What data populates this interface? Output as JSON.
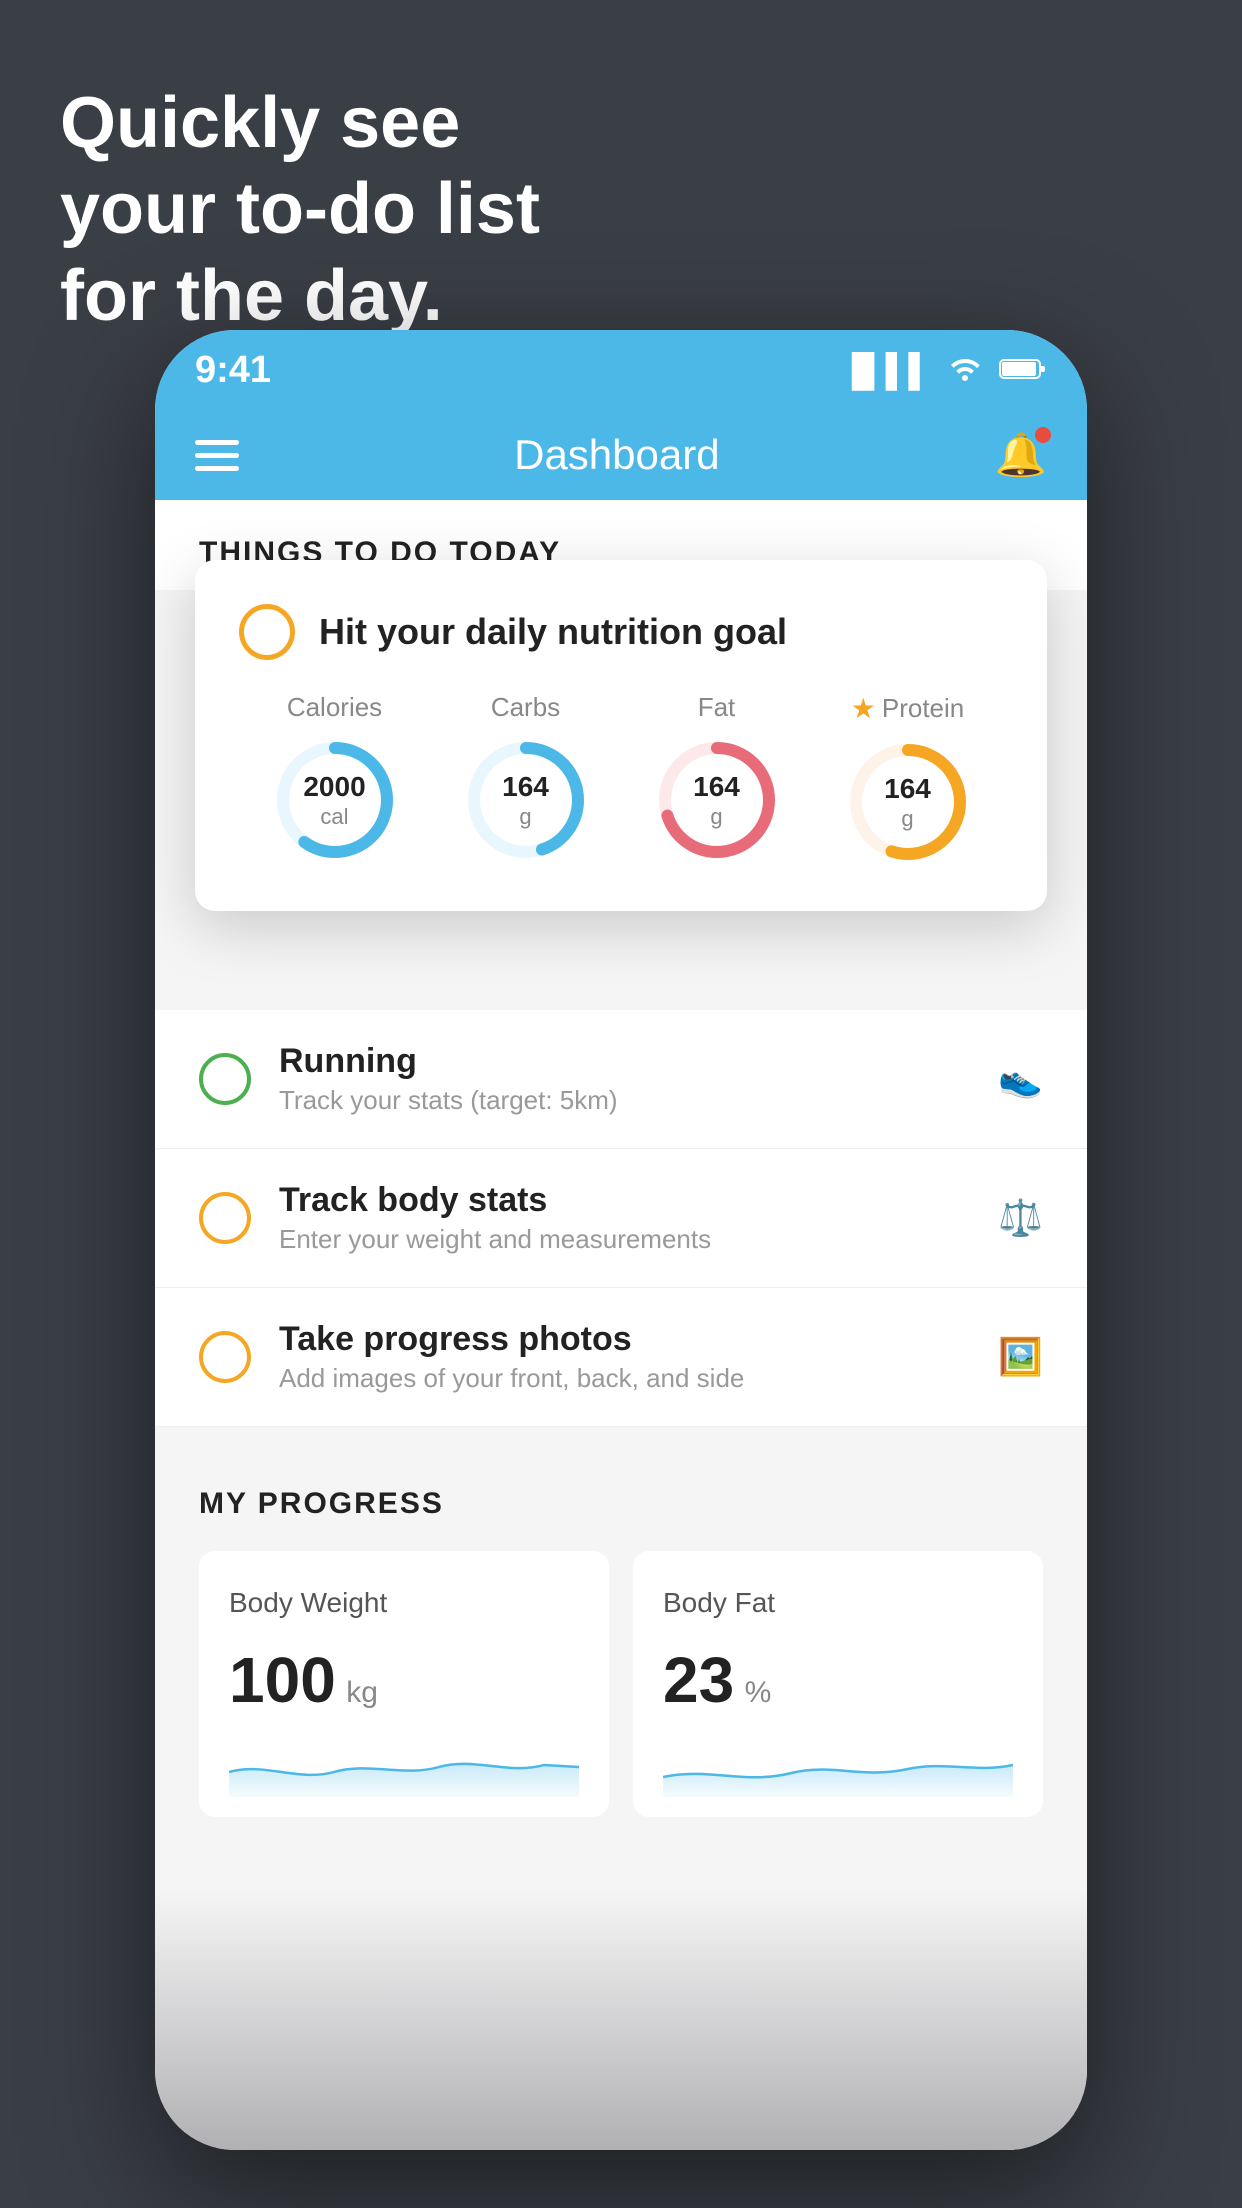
{
  "headline": {
    "line1": "Quickly see",
    "line2": "your to-do list",
    "line3": "for the day."
  },
  "statusBar": {
    "time": "9:41",
    "signal": "▐▌▌▌",
    "wifi": "wifi",
    "battery": "battery"
  },
  "navbar": {
    "title": "Dashboard"
  },
  "sectionHeader": {
    "title": "THINGS TO DO TODAY"
  },
  "floatingCard": {
    "title": "Hit your daily nutrition goal",
    "nutrition": [
      {
        "label": "Calories",
        "value": "2000",
        "unit": "cal",
        "color": "#4bb8e8",
        "bg": "#e8f6fd",
        "pct": 60
      },
      {
        "label": "Carbs",
        "value": "164",
        "unit": "g",
        "color": "#4bb8e8",
        "bg": "#e8f6fd",
        "pct": 45
      },
      {
        "label": "Fat",
        "value": "164",
        "unit": "g",
        "color": "#e86b7a",
        "bg": "#fde8ea",
        "pct": 70
      },
      {
        "label": "Protein",
        "value": "164",
        "unit": "g",
        "color": "#f5a623",
        "bg": "#fdf3e8",
        "pct": 55,
        "star": true
      }
    ]
  },
  "todoItems": [
    {
      "name": "Running",
      "sub": "Track your stats (target: 5km)",
      "circleColor": "green",
      "icon": "👟"
    },
    {
      "name": "Track body stats",
      "sub": "Enter your weight and measurements",
      "circleColor": "yellow",
      "icon": "⚖️"
    },
    {
      "name": "Take progress photos",
      "sub": "Add images of your front, back, and side",
      "circleColor": "yellow",
      "icon": "🖼️"
    }
  ],
  "progressSection": {
    "title": "MY PROGRESS",
    "cards": [
      {
        "title": "Body Weight",
        "value": "100",
        "unit": "kg"
      },
      {
        "title": "Body Fat",
        "value": "23",
        "unit": "%"
      }
    ]
  }
}
